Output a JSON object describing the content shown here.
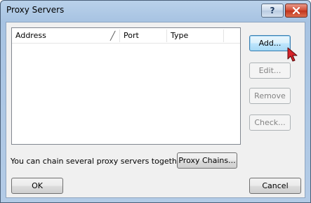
{
  "window": {
    "title": "Proxy Servers",
    "help_label": "?"
  },
  "list": {
    "columns": [
      "Address",
      "Port",
      "Type"
    ],
    "rows": []
  },
  "buttons": {
    "add": "Add...",
    "edit": "Edit...",
    "remove": "Remove",
    "check": "Check...",
    "proxy_chains": "Proxy Chains...",
    "ok": "OK",
    "cancel": "Cancel"
  },
  "chain_label": "You can chain several proxy servers together:",
  "icons": {
    "help": "help-icon",
    "close": "close-icon",
    "cursor": "mouse-pointer-icon"
  },
  "colors": {
    "accent_default_button": "#3c7fb1",
    "close_button": "#c0321b",
    "titlebar": "#b9d1ea"
  }
}
